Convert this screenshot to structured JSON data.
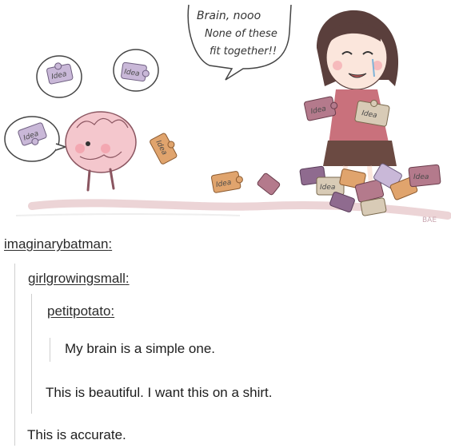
{
  "illustration": {
    "speech_lines": [
      "Brain, nooo",
      "None of these",
      "fit together!!"
    ],
    "piece_label": "Idea",
    "watermark": "BAE"
  },
  "thread": {
    "users": [
      "imaginarybatman",
      "girlgrowingsmall",
      "petitpotato"
    ],
    "colon": ":",
    "posts": [
      "My brain is a simple one.",
      "This is beautiful. I want this on a shirt.",
      "This is accurate."
    ]
  }
}
